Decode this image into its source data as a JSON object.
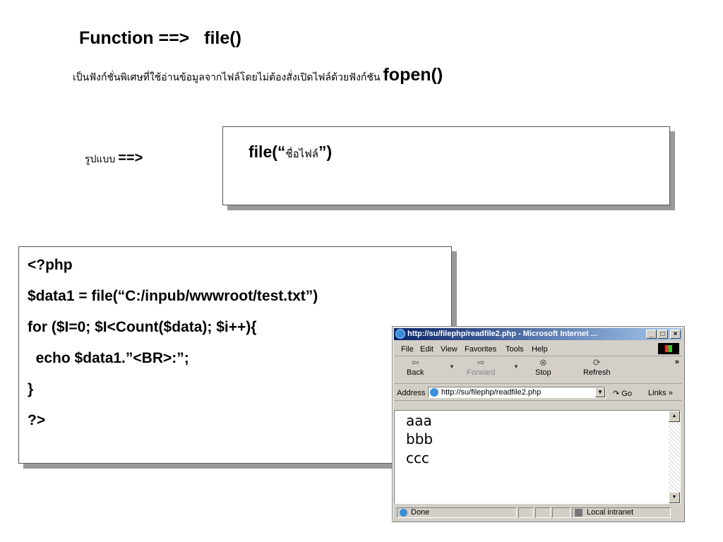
{
  "heading": {
    "prefix": "Function ==>",
    "fn": "file()"
  },
  "description": {
    "thai": "เป็นฟังก์ชั่นพิเศษที่ใช้อ่านข้อมูลจากไฟล์โดยไม่ต้องสั่งเปิดไฟล์ด้วยฟังก์ชัน",
    "fn": "fopen()"
  },
  "format": {
    "label": "รูปแบบ",
    "arrow": "==>"
  },
  "syntax": {
    "open": "file(“",
    "arg": "ชื่อไฟล์",
    "close": "”)"
  },
  "code": [
    "<?php",
    "$data1 = file(“C:/inpub/wwwroot/test.txt”)",
    "for ($I=0; $I<Count($data); $i++){",
    "  echo $data1.”<BR>:”;",
    "}",
    "?>"
  ],
  "browser": {
    "title": "http://su/filephp/readfile2.php - Microsoft Internet ...",
    "minimize": "_",
    "maximize": "□",
    "close": "×",
    "menu": [
      "File",
      "Edit",
      "View",
      "Favorites",
      "Tools",
      "Help"
    ],
    "toolbar": {
      "back": "Back",
      "forward": "Forward",
      "stop": "Stop",
      "refresh": "Refresh",
      "more": "»"
    },
    "address_label": "Address",
    "address_value": "http://su/filephp/readfile2.php",
    "go": "Go",
    "links": "Links »",
    "content_lines": [
      "aaa",
      "bbb",
      "ccc"
    ],
    "status": "Done",
    "zone": "Local intranet"
  }
}
